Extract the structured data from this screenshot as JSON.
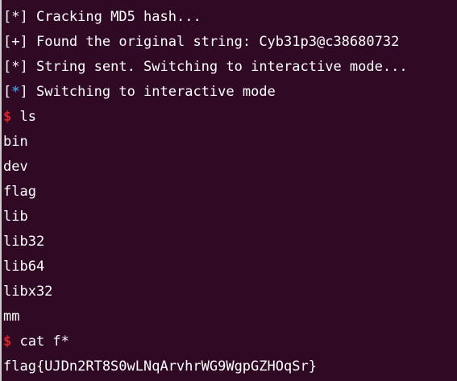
{
  "terminal": {
    "colors": {
      "background": "#300a24",
      "text": "#ffffff",
      "prompt": "#e0242a",
      "info_star": "#3f8fd6"
    },
    "log": [
      {
        "bracket_open": "[",
        "sym": "*",
        "bracket_close": "]",
        "text": " Cracking MD5 hash..."
      },
      {
        "bracket_open": "[",
        "sym": "+",
        "bracket_close": "]",
        "text": " Found the original string: Cyb31p3@c38680732"
      },
      {
        "bracket_open": "[",
        "sym": "*",
        "bracket_close": "]",
        "text": " String sent. Switching to interactive mode..."
      },
      {
        "bracket_open": "[",
        "sym": "*",
        "bracket_close": "]",
        "text": " Switching to interactive mode"
      }
    ],
    "prompt_symbol": "$",
    "commands": [
      {
        "cmd": " ls"
      },
      {
        "cmd": " cat f*"
      }
    ],
    "ls_output": [
      "bin",
      "dev",
      "flag",
      "lib",
      "lib32",
      "lib64",
      "libx32",
      "mm"
    ],
    "flag_output": "flag{UJDn2RT8S0wLNqArvhrWG9WgpGZHOqSr}"
  }
}
